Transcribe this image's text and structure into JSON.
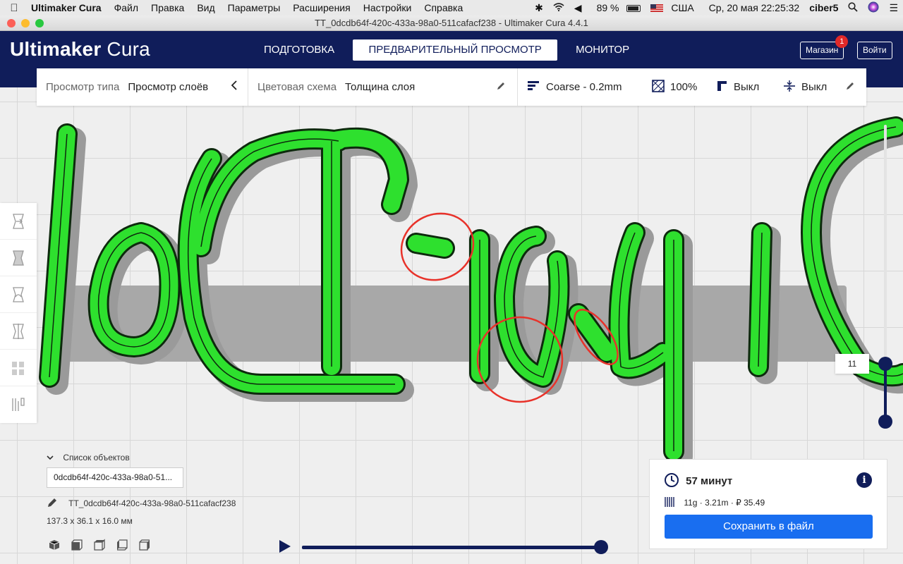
{
  "menubar": {
    "apple": "",
    "app_name": "Ultimaker Cura",
    "items": [
      "Файл",
      "Правка",
      "Вид",
      "Параметры",
      "Расширения",
      "Настройки",
      "Справка"
    ],
    "battery": "89 %",
    "keyboard": "США",
    "datetime": "Ср, 20 мая  22:25:32",
    "user": "ciber5"
  },
  "window": {
    "title": "TT_0dcdb64f-420c-433a-98a0-511cafacf238 - Ultimaker Cura 4.4.1"
  },
  "header": {
    "logo_bold": "Ultimaker",
    "logo_light": " Cura",
    "stages": [
      "ПОДГОТОВКА",
      "ПРЕДВАРИТЕЛЬНЫЙ ПРОСМОТР",
      "МОНИТОР"
    ],
    "active_stage": "ПРЕДВАРИТЕЛЬНЫЙ ПРОСМОТР",
    "marketplace": "Магазин",
    "marketplace_badge": "1",
    "signin": "Войти"
  },
  "viewbar": {
    "view_type_label": "Просмотр типа",
    "view_type_value": "Просмотр слоёв",
    "color_scheme_label": "Цветовая схема",
    "color_scheme_value": "Толщина слоя",
    "profile": "Coarse - 0.2mm",
    "infill": "100%",
    "support": "Выкл",
    "adhesion": "Выкл"
  },
  "layer_slider": {
    "current_layer": "11"
  },
  "objects": {
    "header": "Список объектов",
    "selected": "0dcdb64f-420c-433a-98a0-51...",
    "name": "TT_0dcdb64f-420c-433a-98a0-511cafacf238",
    "dimensions": "137.3 x 36.1 x 16.0 мм"
  },
  "simulation": {
    "progress": 1.0
  },
  "print_info": {
    "time": "57 минут",
    "material": "11g · 3.21m · ₽ 35.49",
    "save_button": "Сохранить в файл"
  },
  "colors": {
    "header_bg": "#101d5a",
    "accent_blue": "#196ef0",
    "layer_green": "#2ee02e",
    "annotation_red": "#e8322a",
    "badge_red": "#e02929"
  }
}
